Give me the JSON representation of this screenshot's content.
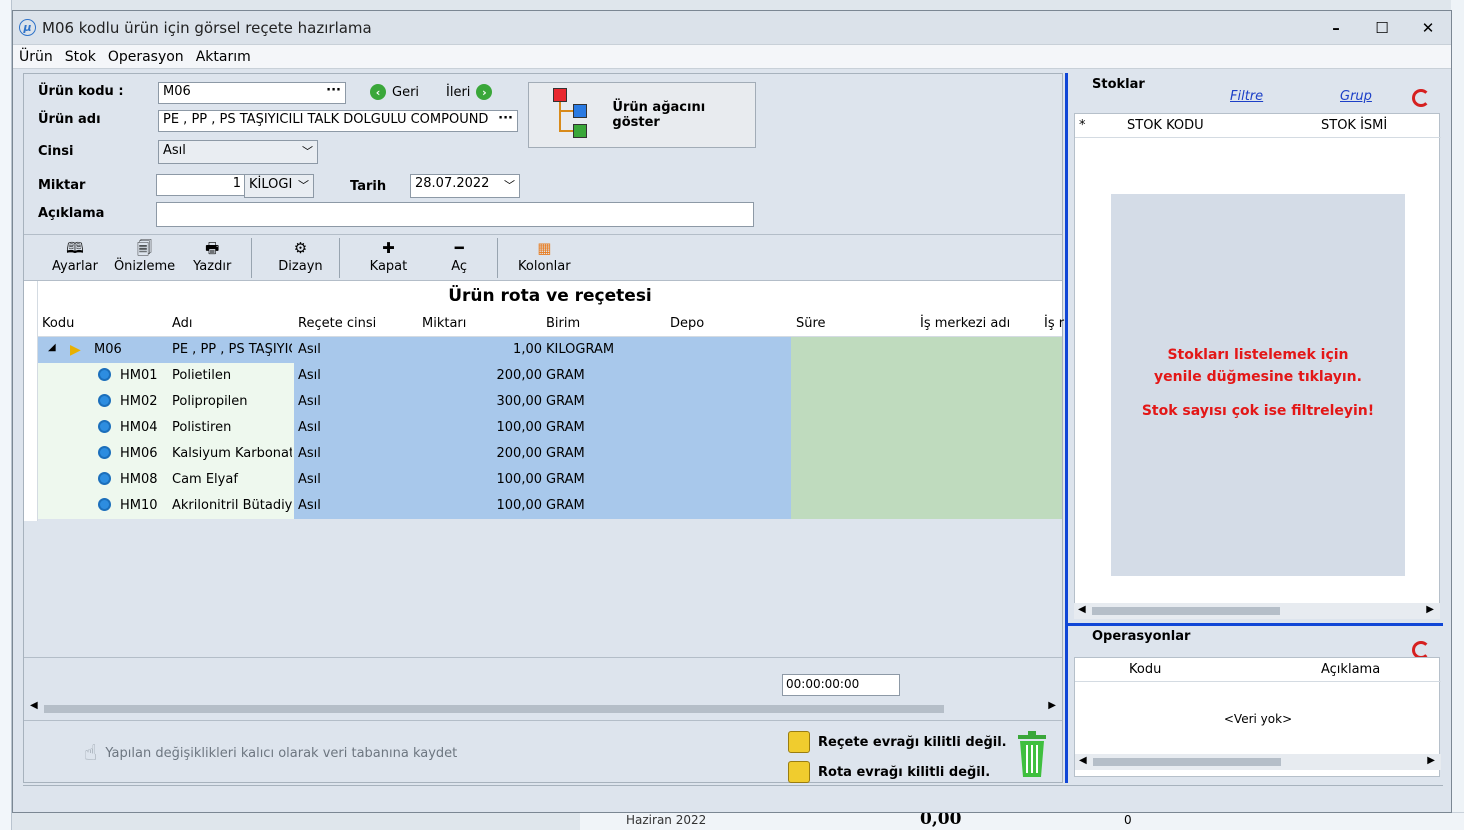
{
  "window": {
    "title": "M06 kodlu ürün için görsel reçete hazırlama"
  },
  "menu": [
    "Ürün",
    "Stok",
    "Operasyon",
    "Aktarım"
  ],
  "form": {
    "urun_kodu_label": "Ürün kodu :",
    "urun_kodu_value": "M06",
    "urun_adi_label": "Ürün adı",
    "urun_adi_value": "PE , PP , PS TAŞIYICILI TALK DOLGULU COMPOUND",
    "cinsi_label": "Cinsi",
    "cinsi_value": "Asıl",
    "miktar_label": "Miktar",
    "miktar_value": "1",
    "miktar_unit": "KİLOGI",
    "tarih_label": "Tarih",
    "tarih_value": "28.07.2022",
    "aciklama_label": "Açıklama",
    "aciklama_value": "",
    "geri": "Geri",
    "ileri": "İleri",
    "tree_button": "Ürün ağacını göster"
  },
  "toolbar": [
    "Ayarlar",
    "Önizleme",
    "Yazdır",
    "Dizayn",
    "Kapat",
    "Aç",
    "Kolonlar"
  ],
  "grid": {
    "title": "Ürün rota ve reçetesi",
    "columns": [
      "Kodu",
      "Adı",
      "Reçete cinsi",
      "Miktarı",
      "Birim",
      "Depo",
      "Süre",
      "İş merkezi adı",
      "İş r"
    ],
    "root": {
      "code": "M06",
      "name": "PE , PP , PS TAŞIYICI",
      "type": "Asıl",
      "qty": "1,00",
      "unit": "KİLOGRAM"
    },
    "rows": [
      {
        "code": "HM01",
        "name": "Polietilen",
        "type": "Asıl",
        "qty": "200,00",
        "unit": "GRAM"
      },
      {
        "code": "HM02",
        "name": "Polipropilen",
        "type": "Asıl",
        "qty": "300,00",
        "unit": "GRAM"
      },
      {
        "code": "HM04",
        "name": "Polistiren",
        "type": "Asıl",
        "qty": "100,00",
        "unit": "GRAM"
      },
      {
        "code": "HM06",
        "name": "Kalsiyum Karbonat",
        "type": "Asıl",
        "qty": "200,00",
        "unit": "GRAM"
      },
      {
        "code": "HM08",
        "name": "Cam Elyaf",
        "type": "Asıl",
        "qty": "100,00",
        "unit": "GRAM"
      },
      {
        "code": "HM10",
        "name": "Akrilonitril Bütadiy",
        "type": "Asıl",
        "qty": "100,00",
        "unit": "GRAM"
      }
    ],
    "total_time": "00:00:00:00"
  },
  "footer": {
    "save": "Yapılan değişiklikleri kalıcı olarak veri tabanına kaydet",
    "recete_lock": "Reçete evrağı kilitli değil.",
    "rota_lock": "Rota evrağı kilitli değil."
  },
  "stoklar": {
    "title": "Stoklar",
    "filtre": "Filtre",
    "grup": "Grup",
    "col_star": "*",
    "col_code": "STOK KODU",
    "col_name": "STOK İSMİ",
    "msg1": "Stokları listelemek için",
    "msg2": "yenile düğmesine tıklayın.",
    "msg3": "Stok sayısı çok ise filtreleyin!"
  },
  "operasyonlar": {
    "title": "Operasyonlar",
    "col_code": "Kodu",
    "col_desc": "Açıklama",
    "empty": "<Veri yok>"
  },
  "background": {
    "month": "Haziran 2022",
    "value": "0,00",
    "zero": "0"
  }
}
